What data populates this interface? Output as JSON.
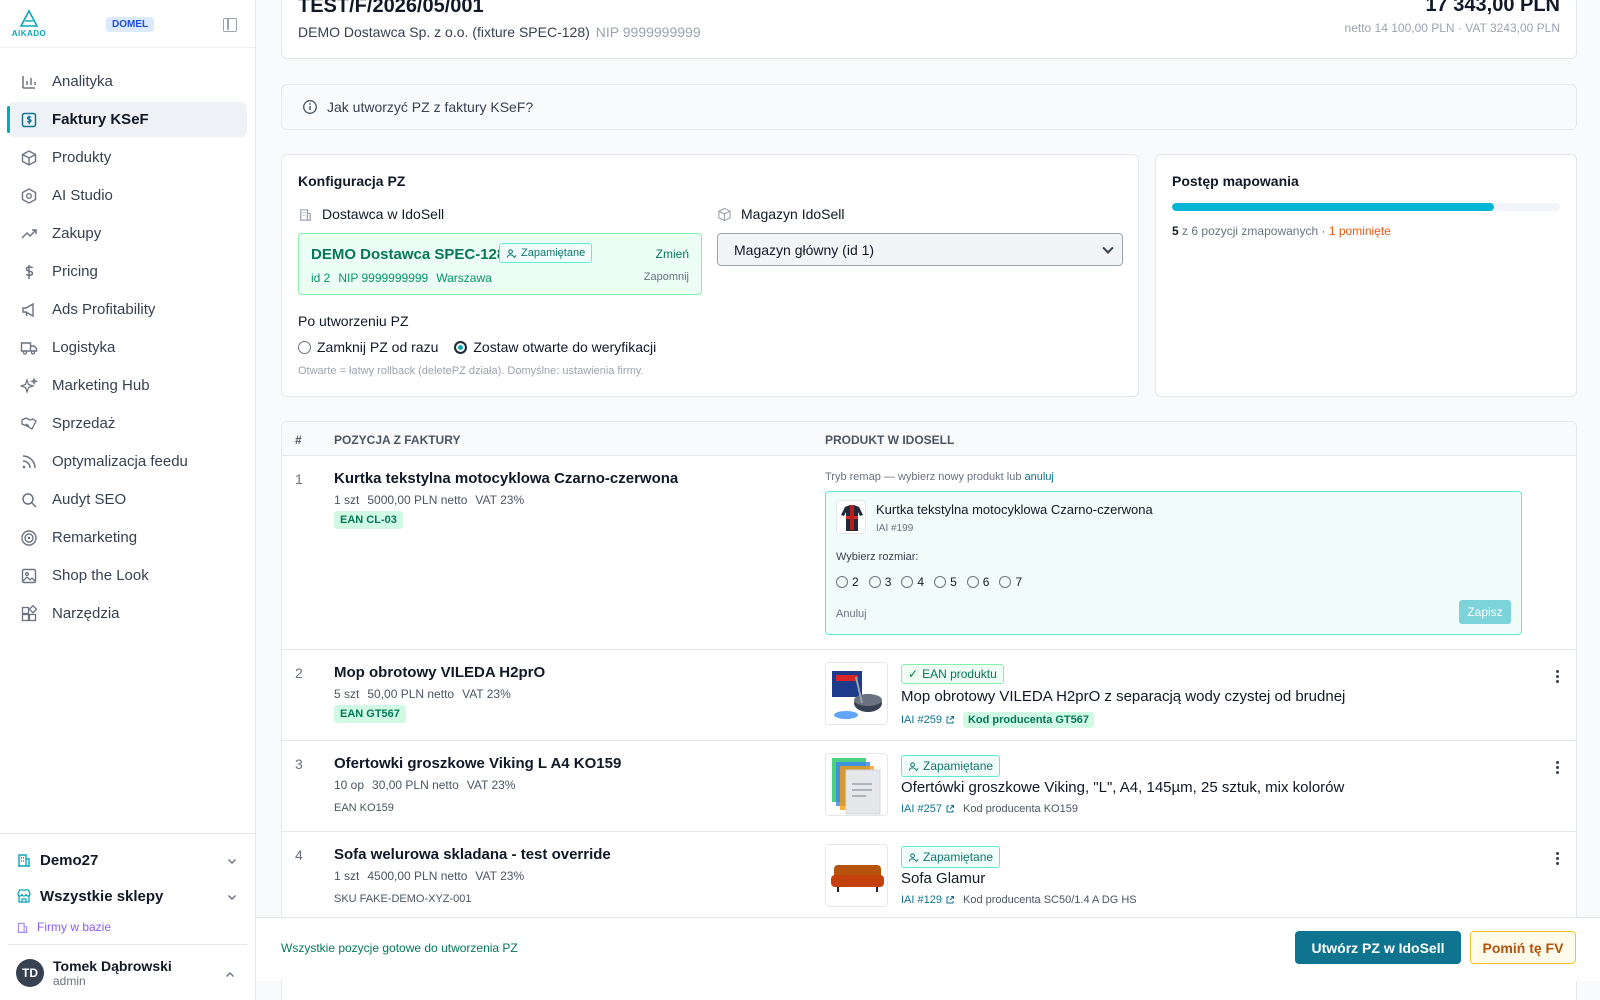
{
  "brand": {
    "logo_text": "AIKADO",
    "badge": "DOMEL"
  },
  "sidebar": {
    "items": [
      {
        "label": "Analityka",
        "icon": "bar-chart-icon"
      },
      {
        "label": "Faktury KSeF",
        "icon": "invoice-dollar-icon",
        "active": true
      },
      {
        "label": "Produkty",
        "icon": "box-icon"
      },
      {
        "label": "AI Studio",
        "icon": "ai-cube-icon"
      },
      {
        "label": "Zakupy",
        "icon": "trending-up-icon"
      },
      {
        "label": "Pricing",
        "icon": "dollar-icon"
      },
      {
        "label": "Ads Profitability",
        "icon": "megaphone-icon"
      },
      {
        "label": "Logistyka",
        "icon": "truck-icon"
      },
      {
        "label": "Marketing Hub",
        "icon": "sparkles-icon"
      },
      {
        "label": "Sprzedaż",
        "icon": "handshake-icon"
      },
      {
        "label": "Optymalizacja feedu",
        "icon": "rss-icon"
      },
      {
        "label": "Audyt SEO",
        "icon": "search-icon"
      },
      {
        "label": "Remarketing",
        "icon": "target-icon"
      },
      {
        "label": "Shop the Look",
        "icon": "image-icon"
      },
      {
        "label": "Narzędzia",
        "icon": "tools-grid-icon"
      }
    ],
    "org": "Demo27",
    "shops": "Wszystkie sklepy",
    "firms_link": "Firmy w bazie",
    "user": {
      "initials": "TD",
      "name": "Tomek Dąbrowski",
      "role": "admin"
    }
  },
  "invoice": {
    "number": "TEST/F/2026/05/001",
    "supplier": "DEMO Dostawca Sp. z o.o. (fixture SPEC-128)",
    "nip": "NIP 9999999999",
    "total": "17 343,00 PLN",
    "subtotal": "netto 14 100,00 PLN · VAT 3243,00 PLN"
  },
  "howto": "Jak utworzyć PZ z faktury KSeF?",
  "config": {
    "title": "Konfiguracja PZ",
    "supplier_label": "Dostawca w IdoSell",
    "supplier_name": "DEMO Dostawca SPEC-128",
    "saved_chip": "Zapamiętane",
    "supplier_id": "id 2",
    "supplier_nip": "NIP 9999999999",
    "supplier_city": "Warszawa",
    "change": "Zmień",
    "forget": "Zapomnij",
    "warehouse_label": "Magazyn IdoSell",
    "warehouse_value": "Magazyn główny (id 1)",
    "after_title": "Po utworzeniu PZ",
    "option_close": "Zamknij PZ od razu",
    "option_open": "Zostaw otwarte do weryfikacji",
    "hint": "Otwarte = łatwy rollback (deletePZ działa). Domyślne: ustawienia firmy."
  },
  "progress": {
    "title": "Postęp mapowania",
    "mapped": 5,
    "total": 6,
    "fraction": 0.83,
    "of_label": "z",
    "mapped_label": "pozycji zmapowanych ·",
    "skipped": "1 pominięte"
  },
  "table": {
    "col_num": "#",
    "col_invoice": "POZYCJA Z FAKTURY",
    "col_product": "PRODUKT W IDOSELL",
    "rows": [
      {
        "num": "1",
        "title": "Kurtka tekstylna motocyklowa Czarno-czerwona",
        "qty": "1 szt",
        "price": "5000,00 PLN netto",
        "vat": "VAT 23%",
        "tag": "EAN CL-03",
        "remap_hint": "Tryb remap — wybierz nowy produkt lub",
        "remap_cancel": "anuluj",
        "product": "Kurtka tekstylna motocyklowa Czarno-czerwona",
        "iai": "IAI #199",
        "size_label": "Wybierz rozmiar:",
        "sizes": [
          "2",
          "3",
          "4",
          "5",
          "6",
          "7"
        ],
        "cancel": "Anuluj",
        "save": "Zapisz"
      },
      {
        "num": "2",
        "title": "Mop obrotowy VILEDA H2prO",
        "qty": "5 szt",
        "price": "50,00 PLN netto",
        "vat": "VAT 23%",
        "tag": "EAN GT567",
        "chip": "EAN produktu",
        "product": "Mop obrotowy VILEDA H2prO z separacją wody czystej od brudnej",
        "iai": "IAI #259",
        "code": "Kod producenta GT567"
      },
      {
        "num": "3",
        "title": "Ofertowki groszkowe Viking L A4 KO159",
        "qty": "10 op",
        "price": "30,00 PLN netto",
        "vat": "VAT 23%",
        "tag": "EAN KO159",
        "chip": "Zapamiętane",
        "product": "Ofertówki groszkowe Viking, \"L\", A4, 145µm, 25 sztuk, mix kolorów",
        "iai": "IAI #257",
        "code": "Kod producenta KO159"
      },
      {
        "num": "4",
        "title": "Sofa welurowa skladana - test override",
        "qty": "1 szt",
        "price": "4500,00 PLN netto",
        "vat": "VAT 23%",
        "tag": "SKU FAKE-DEMO-XYZ-001",
        "chip": "Zapamiętane",
        "product": "Sofa Glamur",
        "iai": "IAI #129",
        "code": "Kod producenta SC50/1.4 A DG HS"
      }
    ]
  },
  "footer": {
    "message": "Wszystkie pozycje gotowe do utworzenia PZ",
    "create": "Utwórz PZ w IdoSell",
    "skip": "Pomiń tę FV"
  },
  "colors": {
    "accent": "#0e7490",
    "success": "#047857",
    "warning": "#b45309"
  }
}
